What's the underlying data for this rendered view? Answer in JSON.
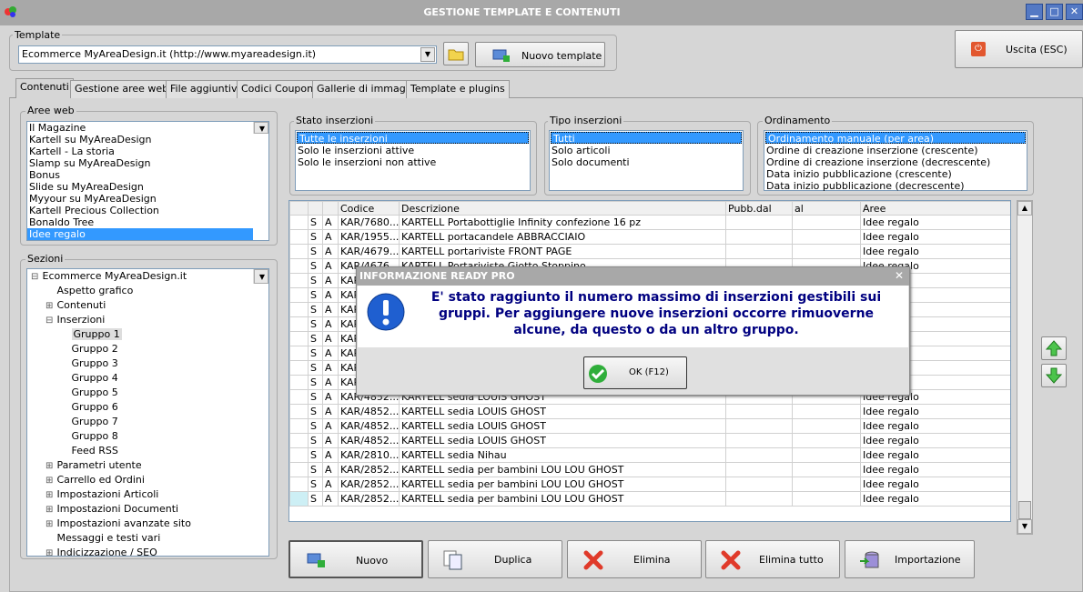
{
  "window": {
    "title": "GESTIONE TEMPLATE E CONTENUTI"
  },
  "template": {
    "label": "Template",
    "value": "Ecommerce MyAreaDesign.it (http://www.myareadesign.it)",
    "new_button": "Nuovo template"
  },
  "exit_button": "Uscita (ESC)",
  "tabs": [
    "Contenuti",
    "Gestione aree web",
    "File aggiuntivi",
    "Codici Coupon",
    "Gallerie di immagini",
    "Template e plugins"
  ],
  "aree_web": {
    "label": "Aree web",
    "items": [
      "Il Magazine",
      "Kartell su MyAreaDesign",
      "Kartell - La storia",
      "Slamp su MyAreaDesign",
      "Bonus",
      "Slide su MyAreaDesign",
      "Myyour su MyAreaDesign",
      "Kartell Precious Collection",
      "Bonaldo Tree",
      "Idee regalo"
    ],
    "selected": "Idee regalo"
  },
  "sezioni": {
    "label": "Sezioni",
    "items": [
      {
        "t": "Ecommerce MyAreaDesign.it",
        "exp": "⊟"
      },
      {
        "t": "Aspetto grafico",
        "exp": ""
      },
      {
        "t": "Contenuti",
        "exp": "⊞"
      },
      {
        "t": "Inserzioni",
        "exp": "⊟"
      },
      {
        "t": "Gruppo 1",
        "exp": ""
      },
      {
        "t": "Gruppo 2",
        "exp": ""
      },
      {
        "t": "Gruppo 3",
        "exp": ""
      },
      {
        "t": "Gruppo 4",
        "exp": ""
      },
      {
        "t": "Gruppo 5",
        "exp": ""
      },
      {
        "t": "Gruppo 6",
        "exp": ""
      },
      {
        "t": "Gruppo 7",
        "exp": ""
      },
      {
        "t": "Gruppo 8",
        "exp": ""
      },
      {
        "t": "Feed RSS",
        "exp": ""
      },
      {
        "t": "Parametri utente",
        "exp": "⊞"
      },
      {
        "t": "Carrello ed Ordini",
        "exp": "⊞"
      },
      {
        "t": "Impostazioni Articoli",
        "exp": "⊞"
      },
      {
        "t": "Impostazioni Documenti",
        "exp": "⊞"
      },
      {
        "t": "Impostazioni avanzate sito",
        "exp": "⊞"
      },
      {
        "t": "Messaggi e testi vari",
        "exp": ""
      },
      {
        "t": "Indicizzazione / SEO",
        "exp": "⊞"
      }
    ]
  },
  "stato": {
    "label": "Stato inserzioni",
    "items": [
      "Tutte le inserzioni",
      "Solo le inserzioni attive",
      "Solo le inserzioni non attive"
    ]
  },
  "tipo": {
    "label": "Tipo inserzioni",
    "items": [
      "Tutti",
      "Solo articoli",
      "Solo documenti"
    ]
  },
  "ordinamento": {
    "label": "Ordinamento",
    "items": [
      "Ordinamento manuale (per area)",
      "Ordine di creazione inserzione (crescente)",
      "Ordine di creazione inserzione (decrescente)",
      "Data inizio pubblicazione (crescente)",
      "Data inizio pubblicazione (decrescente)"
    ]
  },
  "grid": {
    "headers": [
      "",
      "",
      "",
      "Codice",
      "Descrizione",
      "Pubb.dal",
      "al",
      "Aree"
    ],
    "rows": [
      [
        "S",
        "A",
        "KAR/7680...",
        "KARTELL Portabottiglie Infinity confezione 16 pz",
        "",
        "",
        "Idee regalo"
      ],
      [
        "S",
        "A",
        "KAR/1955...",
        "KARTELL portacandele ABBRACCIAIO",
        "",
        "",
        "Idee regalo"
      ],
      [
        "S",
        "A",
        "KAR/4679...",
        "KARTELL portariviste FRONT PAGE",
        "",
        "",
        "Idee regalo"
      ],
      [
        "S",
        "A",
        "KAR/4676...",
        "KARTELL Portariviste Giotto Stoppino",
        "",
        "",
        "Idee regalo"
      ],
      [
        "S",
        "A",
        "KAR",
        "",
        "",
        "",
        ""
      ],
      [
        "S",
        "A",
        "KAR",
        "",
        "",
        "",
        ""
      ],
      [
        "S",
        "A",
        "KAR",
        "",
        "",
        "",
        ""
      ],
      [
        "S",
        "A",
        "KAR",
        "",
        "",
        "",
        ""
      ],
      [
        "S",
        "A",
        "KAR",
        "",
        "",
        "",
        ""
      ],
      [
        "S",
        "A",
        "KAR",
        "",
        "",
        "",
        ""
      ],
      [
        "S",
        "A",
        "KAR",
        "",
        "",
        "",
        ""
      ],
      [
        "S",
        "A",
        "KAR",
        "",
        "",
        "",
        ""
      ],
      [
        "S",
        "A",
        "KAR/4852...",
        "KARTELL sedia LOUIS GHOST",
        "",
        "",
        "Idee regalo"
      ],
      [
        "S",
        "A",
        "KAR/4852...",
        "KARTELL sedia LOUIS GHOST",
        "",
        "",
        "Idee regalo"
      ],
      [
        "S",
        "A",
        "KAR/4852...",
        "KARTELL sedia LOUIS GHOST",
        "",
        "",
        "Idee regalo"
      ],
      [
        "S",
        "A",
        "KAR/4852...",
        "KARTELL sedia LOUIS GHOST",
        "",
        "",
        "Idee regalo"
      ],
      [
        "S",
        "A",
        "KAR/2810...",
        "KARTELL sedia Nihau",
        "",
        "",
        "Idee regalo"
      ],
      [
        "S",
        "A",
        "KAR/2852...",
        "KARTELL sedia per bambini LOU LOU GHOST",
        "",
        "",
        "Idee regalo"
      ],
      [
        "S",
        "A",
        "KAR/2852...",
        "KARTELL sedia per bambini LOU LOU GHOST",
        "",
        "",
        "Idee regalo"
      ],
      [
        "S",
        "A",
        "KAR/2852...",
        "KARTELL sedia per bambini LOU LOU GHOST",
        "",
        "",
        "Idee regalo"
      ]
    ]
  },
  "buttons": {
    "nuovo": "Nuovo",
    "duplica": "Duplica",
    "elimina": "Elimina",
    "elimina_tutto": "Elimina tutto",
    "importazione": "Importazione"
  },
  "dialog": {
    "title": "INFORMAZIONE READY PRO",
    "message": "E' stato raggiunto il numero massimo di inserzioni gestibili sui gruppi. Per aggiungere nuove inserzioni occorre rimuoverne alcune, da questo o da un altro gruppo.",
    "ok": "OK (F12)"
  },
  "colors": {
    "selection": "#3399ff",
    "titlebar": "#a8a8a8",
    "dialog_title": "#a8a8a8"
  }
}
